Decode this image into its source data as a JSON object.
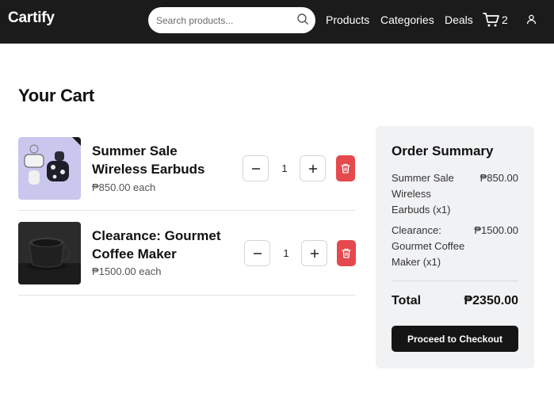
{
  "header": {
    "logo": "Cartify",
    "search": {
      "placeholder": "Search products...",
      "value": ""
    },
    "nav": [
      "Products",
      "Categories",
      "Deals"
    ],
    "cart_count": "2",
    "icons": {
      "search": "search-icon",
      "cart": "cart-icon",
      "user": "user-icon"
    }
  },
  "page": {
    "title": "Your Cart"
  },
  "cart": {
    "items": [
      {
        "name": "Summer Sale Wireless Earbuds",
        "name_lines": [
          "Summer Sale",
          "Wireless Earbuds"
        ],
        "price": "₱850.00 each",
        "quantity": "1",
        "decrement": "−",
        "increment": "+",
        "delete_icon": "trash-icon"
      },
      {
        "name": "Clearance: Gourmet Coffee Maker",
        "name_lines": [
          "Clearance: Gourmet",
          "Coffee Maker"
        ],
        "price": "₱1500.00 each",
        "quantity": "1",
        "decrement": "−",
        "increment": "+",
        "delete_icon": "trash-icon"
      }
    ]
  },
  "summary": {
    "title": "Order Summary",
    "lines": [
      {
        "name_lines": [
          "Summer Sale",
          "Wireless",
          "Earbuds (x1)"
        ],
        "price": "₱850.00"
      },
      {
        "name_lines": [
          "Clearance:",
          "Gourmet Coffee",
          "Maker (x1)"
        ],
        "price": "₱1500.00"
      }
    ],
    "total_label": "Total",
    "total_value": "₱2350.00",
    "checkout_label": "Proceed to Checkout"
  },
  "colors": {
    "header_bg": "#1b1b1b",
    "delete": "#e5484d",
    "summary_bg": "#f1f2f4",
    "checkout_bg": "#151515"
  }
}
